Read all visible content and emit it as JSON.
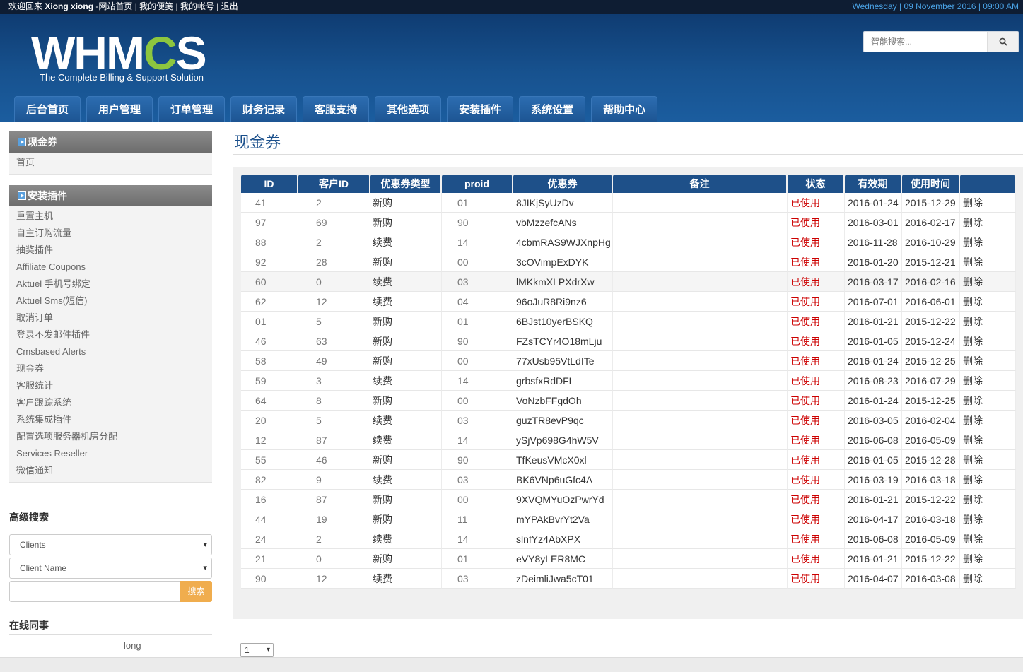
{
  "topbar": {
    "welcome": "欢迎回来",
    "username": "Xiong xiong",
    "links": " -网站首页 | 我的便笺 | 我的帐号 | 退出",
    "datetime": "Wednesday | 09 November 2016 | 09:00 AM"
  },
  "header": {
    "logo_text_a": "WHM",
    "logo_text_b": "C",
    "logo_text_c": "S",
    "logo_tagline": "The Complete Billing & Support Solution",
    "search_placeholder": "智能搜索..."
  },
  "nav": [
    "后台首页",
    "用户管理",
    "订单管理",
    "财务记录",
    "客服支持",
    "其他选项",
    "安装插件",
    "系统设置",
    "帮助中心"
  ],
  "sidebar": {
    "section1": {
      "title": "现金券",
      "items": [
        "首页"
      ]
    },
    "section2": {
      "title": "安装插件",
      "items": [
        "重置主机",
        "自主订购流量",
        "抽奖插件",
        "Affiliate Coupons",
        "Aktuel 手机号绑定",
        "Aktuel Sms(短信)",
        "取消订单",
        "登录不发邮件插件",
        "Cmsbased Alerts",
        "现金券",
        "客服统计",
        "客户跟踪系统",
        "系统集成插件",
        "配置选项服务器机房分配",
        "Services Reseller",
        "微信通知"
      ]
    },
    "advanced_search": {
      "title": "高级搜索",
      "select1": "Clients",
      "select2": "Client Name",
      "button": "搜索"
    },
    "online": {
      "title": "在线同事",
      "user": "long"
    }
  },
  "main": {
    "title": "现金券",
    "columns": [
      "ID",
      "客户ID",
      "优惠券类型",
      "proid",
      "优惠券",
      "备注",
      "状态",
      "有效期",
      "使用时间",
      ""
    ],
    "rows": [
      [
        "41",
        "2",
        "新购",
        "01",
        "8JIKjSyUzDv",
        "",
        "已使用",
        "2016-01-24",
        "2015-12-29",
        "删除"
      ],
      [
        "97",
        "69",
        "新购",
        "90",
        "vbMzzefcANs",
        "",
        "已使用",
        "2016-03-01",
        "2016-02-17",
        "删除"
      ],
      [
        "88",
        "2",
        "续费",
        "14",
        "4cbmRAS9WJXnpHg",
        "",
        "已使用",
        "2016-11-28",
        "2016-10-29",
        "删除"
      ],
      [
        "92",
        "28",
        "新购",
        "00",
        "3cOVimpExDYK",
        "",
        "已使用",
        "2016-01-20",
        "2015-12-21",
        "删除"
      ],
      [
        "60",
        "0",
        "续费",
        "03",
        "lMKkmXLPXdrXw",
        "",
        "已使用",
        "2016-03-17",
        "2016-02-16",
        "删除"
      ],
      [
        "62",
        "12",
        "续费",
        "04",
        "96oJuR8Ri9nz6",
        "",
        "已使用",
        "2016-07-01",
        "2016-06-01",
        "删除"
      ],
      [
        "01",
        "5",
        "新购",
        "01",
        "6BJst10yerBSKQ",
        "",
        "已使用",
        "2016-01-21",
        "2015-12-22",
        "删除"
      ],
      [
        "46",
        "63",
        "新购",
        "90",
        "FZsTCYr4O18mLju",
        "",
        "已使用",
        "2016-01-05",
        "2015-12-24",
        "删除"
      ],
      [
        "58",
        "49",
        "新购",
        "00",
        "77xUsb95VtLdITe",
        "",
        "已使用",
        "2016-01-24",
        "2015-12-25",
        "删除"
      ],
      [
        "59",
        "3",
        "续费",
        "14",
        "grbsfxRdDFL",
        "",
        "已使用",
        "2016-08-23",
        "2016-07-29",
        "删除"
      ],
      [
        "64",
        "8",
        "新购",
        "00",
        "VoNzbFFgdOh",
        "",
        "已使用",
        "2016-01-24",
        "2015-12-25",
        "删除"
      ],
      [
        "20",
        "5",
        "续费",
        "03",
        "guzTR8evP9qc",
        "",
        "已使用",
        "2016-03-05",
        "2016-02-04",
        "删除"
      ],
      [
        "12",
        "87",
        "续费",
        "14",
        "ySjVp698G4hW5V",
        "",
        "已使用",
        "2016-06-08",
        "2016-05-09",
        "删除"
      ],
      [
        "55",
        "46",
        "新购",
        "90",
        "TfKeusVMcX0xl",
        "",
        "已使用",
        "2016-01-05",
        "2015-12-28",
        "删除"
      ],
      [
        "82",
        "9",
        "续费",
        "03",
        "BK6VNp6uGfc4A",
        "",
        "已使用",
        "2016-03-19",
        "2016-03-18",
        "删除"
      ],
      [
        "16",
        "87",
        "新购",
        "00",
        "9XVQMYuOzPwrYd",
        "",
        "已使用",
        "2016-01-21",
        "2015-12-22",
        "删除"
      ],
      [
        "44",
        "19",
        "新购",
        "11",
        "mYPAkBvrYt2Va",
        "",
        "已使用",
        "2016-04-17",
        "2016-03-18",
        "删除"
      ],
      [
        "24",
        "2",
        "续费",
        "14",
        "slnfYz4AbXPX",
        "",
        "已使用",
        "2016-06-08",
        "2016-05-09",
        "删除"
      ],
      [
        "21",
        "0",
        "新购",
        "01",
        "eVY8yLER8MC",
        "",
        "已使用",
        "2016-01-21",
        "2015-12-22",
        "删除"
      ],
      [
        "90",
        "12",
        "续费",
        "03",
        "zDeimliJwa5cT01",
        "",
        "已使用",
        "2016-04-07",
        "2016-03-08",
        "删除"
      ]
    ],
    "highlight_row": 4,
    "pager_value": "1"
  },
  "colors": {
    "topbar": "#0e1d33",
    "header": "#17528f",
    "nav_tab": "#1d5593",
    "table_head": "#1e5089",
    "used_status": "#cc0000",
    "search_button": "#f0ad4e",
    "logo_green": "#8dc63f"
  },
  "icons": {
    "search": "search-icon",
    "sidebar": "play-arrow-icon",
    "dropdown": "chevron-down-icon"
  }
}
